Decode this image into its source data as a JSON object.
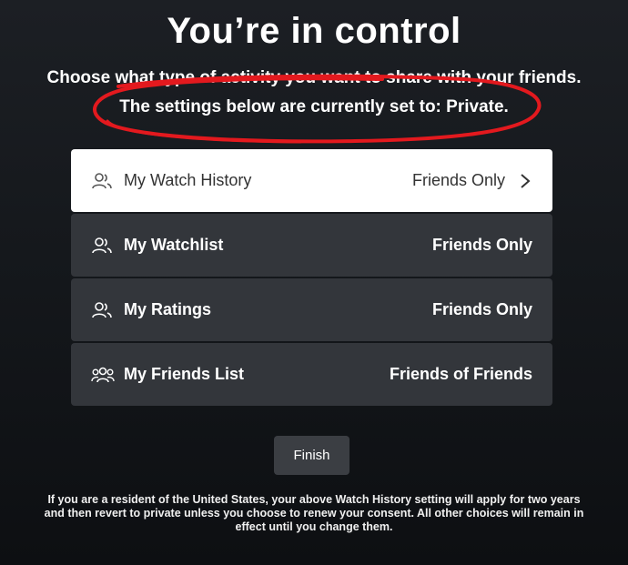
{
  "title": "You’re in control",
  "subtitle_line1": "Choose what type of activity you want to share with your friends.",
  "subtitle_line2": "The settings below are currently set to: Private.",
  "settings": [
    {
      "label": "My Watch History",
      "value": "Friends Only",
      "icon": "person-outline-icon",
      "selected": true
    },
    {
      "label": "My Watchlist",
      "value": "Friends Only",
      "icon": "two-people-icon",
      "selected": false
    },
    {
      "label": "My Ratings",
      "value": "Friends Only",
      "icon": "two-people-icon",
      "selected": false
    },
    {
      "label": "My Friends List",
      "value": "Friends of Friends",
      "icon": "three-people-icon",
      "selected": false
    }
  ],
  "finish_label": "Finish",
  "disclaimer": "If you are a resident of the United States, your above Watch History setting will apply for two years and then revert to private unless you choose to renew your consent. All other choices will remain in effect until you change them.",
  "colors": {
    "annotation_red": "#e3191e",
    "row_bg": "#33363b",
    "row_selected_bg": "#ffffff"
  }
}
